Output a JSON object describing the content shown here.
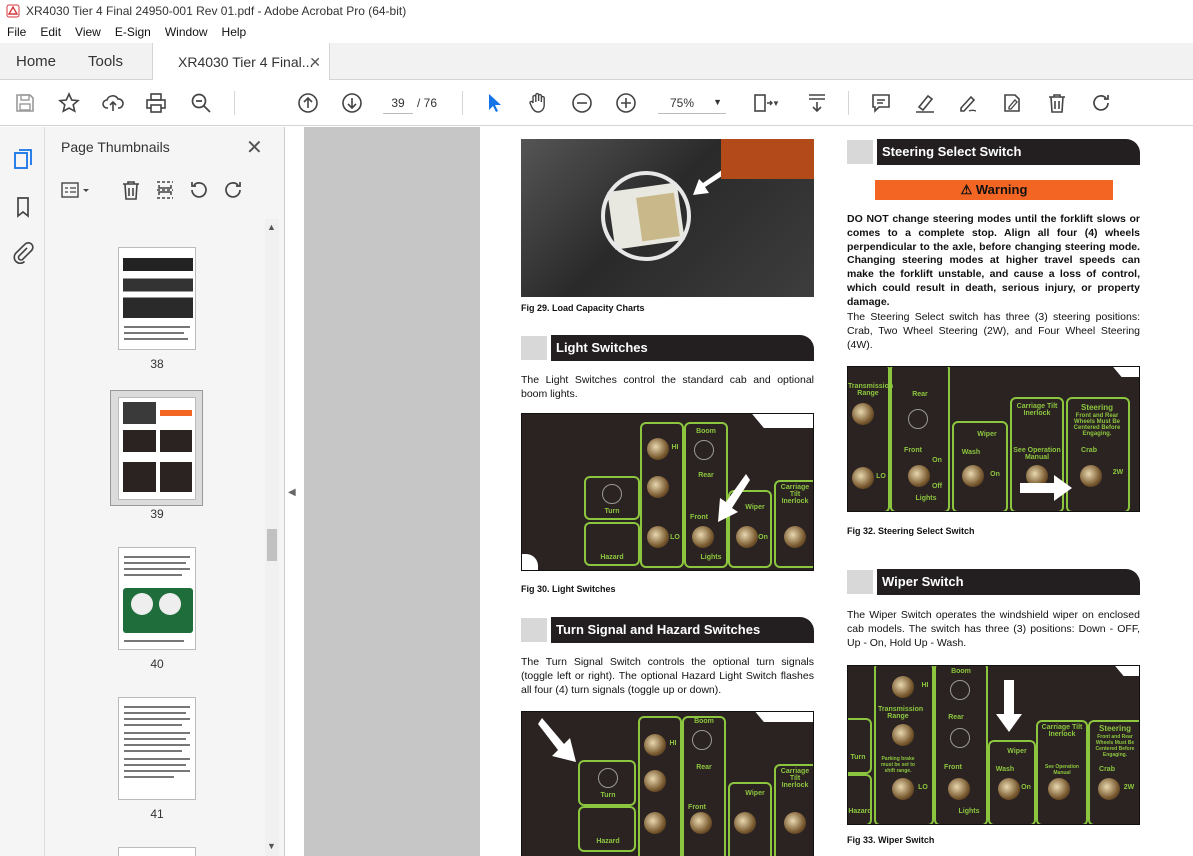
{
  "window": {
    "title": "XR4030 Tier 4 Final 24950-001 Rev 01.pdf - Adobe Acrobat Pro (64-bit)"
  },
  "menu": [
    "File",
    "Edit",
    "View",
    "E-Sign",
    "Window",
    "Help"
  ],
  "tabs": {
    "home": "Home",
    "tools": "Tools",
    "doc": "XR4030 Tier 4 Final..."
  },
  "toolbar": {
    "page_current": "39",
    "page_total": "/ 76",
    "zoom": "75%"
  },
  "sidepanel": {
    "title": "Page Thumbnails",
    "pages": [
      "38",
      "39",
      "40",
      "41"
    ],
    "selected": "39"
  },
  "colors": {
    "accent": "#1473e6",
    "warning": "#f26522",
    "switch_green": "#8cc63f",
    "header_bar": "#231f20"
  },
  "doc": {
    "fig29": "Fig 29.  Load Capacity Charts",
    "light": {
      "heading": "Light Switches",
      "text": "The Light Switches control the standard cab and optional boom lights.",
      "caption": "Fig 30.  Light Switches"
    },
    "turn": {
      "heading": "Turn Signal and Hazard Switches",
      "text": "The Turn Signal Switch controls the optional turn signals (toggle left or right). The optional Hazard Light Switch flashes all four (4) turn signals (toggle up or down)."
    },
    "steering": {
      "heading": "Steering Select Switch",
      "warning": "⚠ Warning",
      "warning_text": "DO NOT change steering modes until the forklift slows or comes to a complete stop. Align all four (4) wheels perpendicular to the axle, before changing steering mode. Changing steering modes at higher travel speeds can make the forklift unstable, and cause a loss of control, which could result in death, serious injury, or property damage.",
      "text": "The Steering Select switch has three (3) steering positions: Crab, Two Wheel Steering (2W), and Four Wheel Steering (4W).",
      "caption": "Fig 32.  Steering Select Switch"
    },
    "wiper": {
      "heading": "Wiper Switch",
      "text": "The Wiper Switch operates the windshield wiper on enclosed cab models.  The switch has three (3) positions: Down - OFF, Up - On, Hold Up - Wash.",
      "caption": "Fig 33.  Wiper Switch"
    },
    "panel_labels": {
      "hi": "HI",
      "lo": "LO",
      "boom": "Boom",
      "rear": "Rear",
      "front": "Front",
      "on": "On",
      "off": "Off",
      "lights": "Lights",
      "turn": "Turn",
      "hazard": "Hazard",
      "wiper": "Wiper",
      "wash": "Wash",
      "transmission": "Transmission Range",
      "parking": "Parking brake must be set to shift range.",
      "carriage": "Carriage Tilt Inerlock",
      "see_manual": "See Operation Manual",
      "steering": "Steering",
      "steering_note": "Front and Rear Wheels Must Be Centered Before Engaging.",
      "crab": "Crab",
      "two_w": "2W"
    }
  }
}
